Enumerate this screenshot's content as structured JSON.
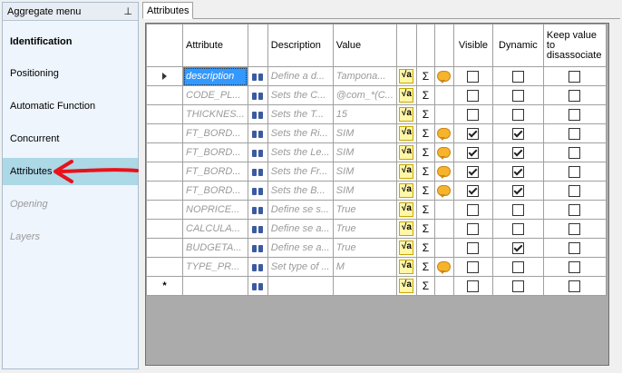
{
  "sidebar": {
    "title": "Aggregate menu",
    "pin": "ᵖ",
    "items": [
      {
        "label": "Identification",
        "state": "active"
      },
      {
        "label": "Positioning",
        "state": "normal"
      },
      {
        "label": "Automatic Function",
        "state": "normal"
      },
      {
        "label": "Concurrent",
        "state": "normal"
      },
      {
        "label": "Attributes",
        "state": "selected"
      },
      {
        "label": "Opening",
        "state": "disabled"
      },
      {
        "label": "Layers",
        "state": "disabled"
      }
    ]
  },
  "tabs": [
    {
      "label": "Attributes"
    }
  ],
  "grid": {
    "columns": {
      "attribute": "Attribute",
      "description": "Description",
      "value": "Value",
      "visible": "Visible",
      "dynamic": "Dynamic",
      "keep": "Keep value to disassociate"
    },
    "rows": [
      {
        "attribute": "description",
        "description": "Define a d...",
        "value": "Tampona...",
        "bubble": true,
        "visible": false,
        "dynamic": false,
        "keep": false,
        "current": true
      },
      {
        "attribute": "CODE_PL...",
        "description": "Sets the C...",
        "value": "@com_*(C...",
        "bubble": false,
        "visible": false,
        "dynamic": false,
        "keep": false
      },
      {
        "attribute": "THICKNES...",
        "description": "Sets the T...",
        "value": "15",
        "bubble": false,
        "visible": false,
        "dynamic": false,
        "keep": false
      },
      {
        "attribute": "FT_BORD...",
        "description": "Sets the Ri...",
        "value": "SIM",
        "bubble": true,
        "visible": true,
        "dynamic": true,
        "keep": false
      },
      {
        "attribute": "FT_BORD...",
        "description": "Sets the Le...",
        "value": "SIM",
        "bubble": true,
        "visible": true,
        "dynamic": true,
        "keep": false
      },
      {
        "attribute": "FT_BORD...",
        "description": "Sets the Fr...",
        "value": "SIM",
        "bubble": true,
        "visible": true,
        "dynamic": true,
        "keep": false
      },
      {
        "attribute": "FT_BORD...",
        "description": "Sets the B...",
        "value": "SIM",
        "bubble": true,
        "visible": true,
        "dynamic": true,
        "keep": false
      },
      {
        "attribute": "NOPRICE...",
        "description": "Define se s...",
        "value": "True",
        "bubble": false,
        "visible": false,
        "dynamic": false,
        "keep": false
      },
      {
        "attribute": "CALCULA...",
        "description": "Define se a...",
        "value": "True",
        "bubble": false,
        "visible": false,
        "dynamic": false,
        "keep": false
      },
      {
        "attribute": "BUDGETA...",
        "description": "Define se a...",
        "value": "True",
        "bubble": false,
        "visible": false,
        "dynamic": true,
        "keep": false
      },
      {
        "attribute": "TYPE_PR...",
        "description": "Set type of ...",
        "value": "M",
        "bubble": true,
        "visible": false,
        "dynamic": false,
        "keep": false
      },
      {
        "attribute": "",
        "description": "",
        "value": "",
        "bubble": false,
        "visible": false,
        "dynamic": false,
        "keep": false,
        "newrow": true
      }
    ]
  },
  "icons": {
    "current_row": "triangle-right",
    "new_row": "*",
    "search": "binoculars",
    "formula": "√a",
    "sum": "Σ",
    "comment": "speech-bubble"
  },
  "colors": {
    "selection": "#3399ff",
    "sidebar_selected": "#add8e6",
    "arrow": "#e8121b"
  }
}
